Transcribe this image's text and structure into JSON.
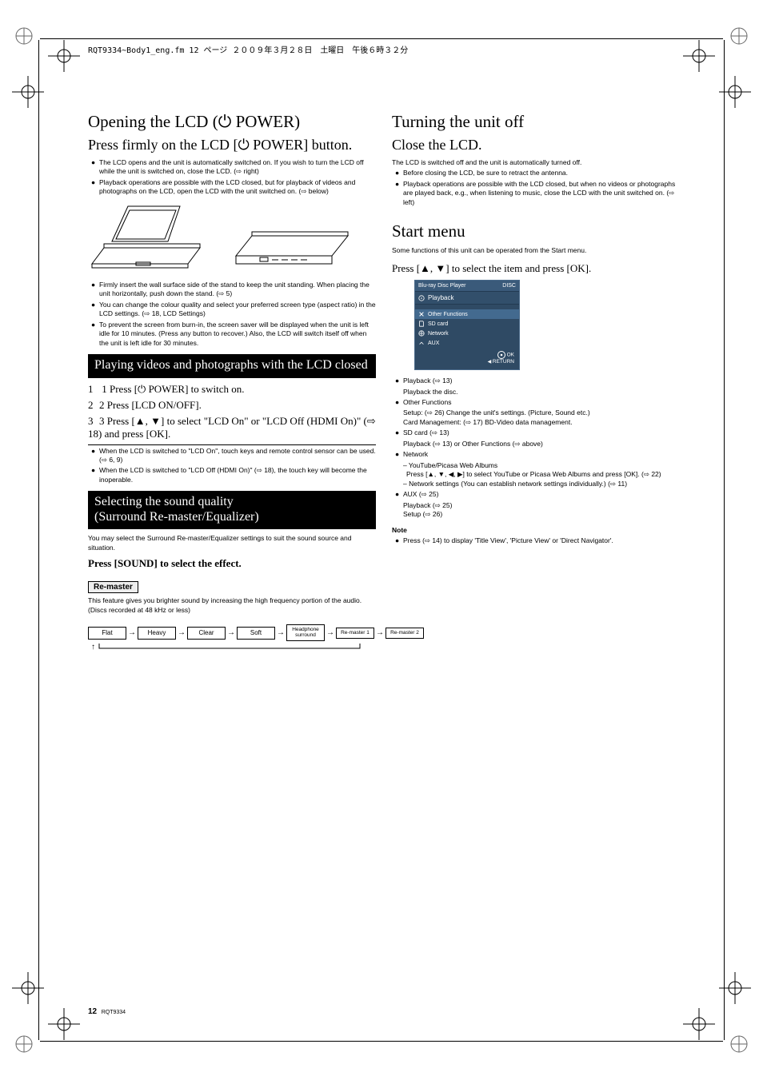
{
  "meta": {
    "top_banner": "RQT9334~Body1_eng.fm  12 ページ  ２００９年３月２８日　土曜日　午後６時３２分",
    "page_number_label": "12",
    "page_code": "RQT9334"
  },
  "left": {
    "h1_prefix": "Opening the LCD (",
    "h1_sym": "⏻",
    "h1_suffix": " POWER)",
    "h2_prefix": "Press firmly on the LCD [",
    "h2_sym": "⏻",
    "h2_suffix": " POWER] button.",
    "bullets": [
      "The LCD opens and the unit is automatically switched on. If you wish to turn the LCD off while the unit is switched on, close the LCD. (⇨ right)",
      "Playback operations are possible with the LCD closed, but for playback of videos and photographs on the LCD, open the LCD with the unit switched on. (⇨ below)"
    ],
    "after_img_bullets": [
      "Firmly insert the wall surface side of the stand to keep the unit standing. When placing the unit horizontally, push down the stand. (⇨ 5)",
      "You can change the colour quality and select your preferred screen type (aspect ratio) in the LCD settings. (⇨ 18, LCD Settings)",
      "To prevent the screen from burn-in, the screen saver will be displayed when the unit is left idle for 10 minutes. (Press any button to recover.) Also, the LCD will switch itself off when the unit is left idle for 30 minutes."
    ],
    "bar1": "Playing videos and photographs with the LCD closed",
    "step1_prefix": "1 Press [",
    "step1_sym": "⏻",
    "step1_suffix": " POWER] to switch on.",
    "step2": "2 Press [LCD ON/OFF].",
    "step3": "3 Press [▲, ▼] to select \"LCD On\" or \"LCD Off (HDMI On)\" (⇨ 18) and press [OK].",
    "post_step_bullets": [
      "When the LCD is switched to \"LCD On\", touch keys and remote control sensor can be used. (⇨ 6, 9)",
      "When the LCD is switched to \"LCD Off (HDMI On)\" (⇨ 18), the touch key will become the inoperable."
    ],
    "bar2_line1": "Selecting the sound quality",
    "bar2_line2": "(Surround Re-master/Equalizer)",
    "sound_p1": "You may select the Surround Re-master/Equalizer settings to suit the sound source and situation.",
    "sound_p2": "Press [SOUND] to select the effect.",
    "caution_label": "Re-master",
    "caution_text": "This feature gives you brighter sound by increasing the high frequency portion of the audio. (Discs recorded at 48 kHz or less)",
    "eq": [
      "Flat",
      "Heavy",
      "Clear",
      "Soft",
      "Headphone surround",
      "Re-master 1",
      "Re-master 2"
    ],
    "loop_arrow": "↑"
  },
  "right": {
    "h1": "Turning the unit off",
    "h2": "Close the LCD.",
    "p1": "The LCD is switched off and the unit is automatically turned off.",
    "bullets_top": [
      "Before closing the LCD, be sure to retract the antenna.",
      "Playback operations are possible with the LCD closed, but when no videos or photographs are played back, e.g., when listening to music, close the LCD with the unit switched on. (⇨ left)"
    ],
    "h1b": "Start menu",
    "p2": "Some functions of this unit can be operated from the Start menu.",
    "preview": {
      "header_left": "Blu-ray Disc Player",
      "header_right": "DISC",
      "row_playback": "Playback",
      "row_other": "Other Functions",
      "items": [
        "SD card",
        "Network",
        "AUX"
      ],
      "footer_ok": "OK",
      "footer_return": "RETURN"
    },
    "after_preview_bullets": [
      "Playback (⇨ 13)",
      "Playback the disc.",
      "Other Functions",
      "     Setup: (⇨ 26) Change the unit's settings. (Picture, Sound etc.)",
      "     Card Management: (⇨ 17) BD-Video data management.",
      "SD card (⇨ 13)",
      "Playback (⇨ 13) or Other Functions (⇨ above)",
      "Network",
      "   – YouTube/Picasa Web Albums",
      "     Press [▲, ▼, ◀, ▶] to select YouTube or Picasa Web Albums and press [OK]. (⇨ 22)",
      "   – Network settings (You can establish network settings individually.) (⇨ 11)",
      "AUX (⇨ 25)",
      "Playback (⇨ 25)",
      "Setup (⇨ 26)"
    ],
    "note": "Note",
    "note_bullet": "Press (⇨ 14) to display 'Title View', 'Picture View' or 'Direct Navigator'."
  }
}
